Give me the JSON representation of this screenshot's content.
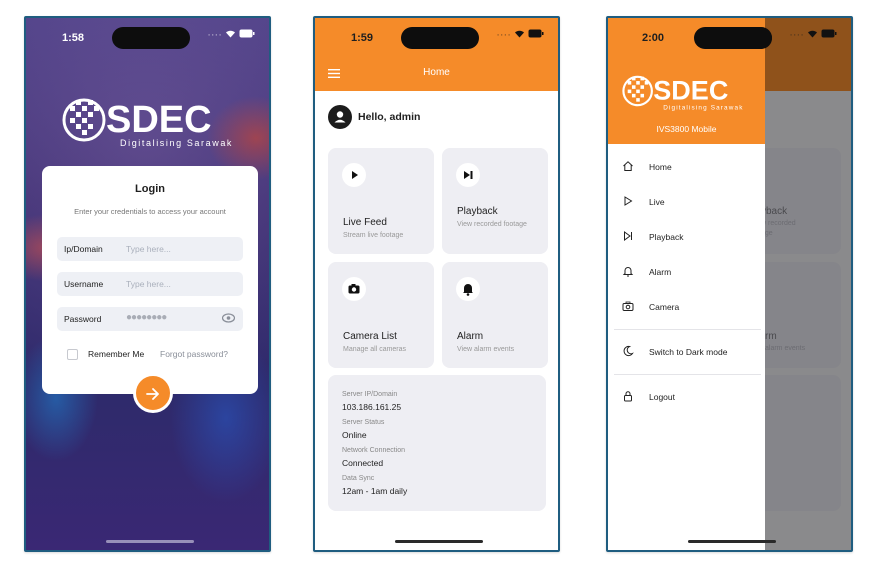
{
  "login_screen": {
    "time": "1:58",
    "brand": "SDEC",
    "tagline": "Digitalising Sarawak",
    "title": "Login",
    "subtitle": "Enter your credentials to access your account",
    "fields": [
      {
        "label": "Ip/Domain",
        "placeholder": "Type here..."
      },
      {
        "label": "Username",
        "placeholder": "Type here..."
      },
      {
        "label": "Password",
        "value": "●●●●●●●●"
      }
    ],
    "remember_label": "Remember Me",
    "forgot_label": "Forgot password?",
    "submit_icon": "arrow-right-icon"
  },
  "home_screen": {
    "time": "1:59",
    "header_title": "Home",
    "greeting": "Hello, admin",
    "tiles": [
      {
        "title": "Live Feed",
        "subtitle": "Stream live footage",
        "icon": "play-icon"
      },
      {
        "title": "Playback",
        "subtitle": "View recorded footage",
        "icon": "skip-next-icon"
      },
      {
        "title": "Camera List",
        "subtitle": "Manage all cameras",
        "icon": "camera-icon"
      },
      {
        "title": "Alarm",
        "subtitle": "View alarm events",
        "icon": "bell-icon"
      }
    ],
    "info": [
      {
        "key": "Server IP/Domain",
        "value": "103.186.161.25"
      },
      {
        "key": "Server Status",
        "value": "Online"
      },
      {
        "key": "Network Connection",
        "value": "Connected"
      },
      {
        "key": "Data Sync",
        "value": "12am - 1am daily"
      }
    ]
  },
  "drawer_screen": {
    "time": "2:00",
    "brand": "SDEC",
    "tagline": "Digitalising Sarawak",
    "app_name": "IVS3800 Mobile",
    "nav": [
      {
        "label": "Home",
        "icon": "home-icon"
      },
      {
        "label": "Live",
        "icon": "play-icon"
      },
      {
        "label": "Playback",
        "icon": "skip-next-icon"
      },
      {
        "label": "Alarm",
        "icon": "bell-icon"
      },
      {
        "label": "Camera",
        "icon": "camera-icon"
      }
    ],
    "dark_mode_label": "Switch to Dark mode",
    "logout_label": "Logout",
    "behind": {
      "tile1_title": "yback",
      "tile1_sub_a": "w recorded",
      "tile1_sub_b": "age",
      "tile2_title": "rm",
      "tile2_sub": "alarm events"
    }
  },
  "colors": {
    "accent": "#f58b29",
    "login_bg": "#3d2f73",
    "tile_bg": "#eeeef3"
  }
}
